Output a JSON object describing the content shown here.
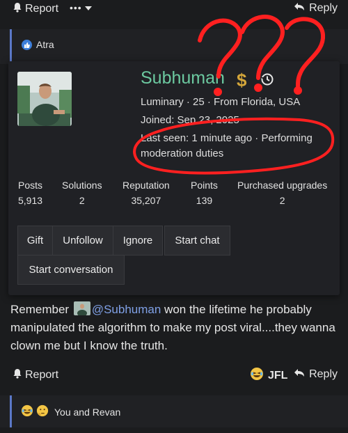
{
  "top": {
    "report_label": "Report",
    "more_label": "•••",
    "reply_label": "Reply"
  },
  "quote": {
    "user": "Atra"
  },
  "profile": {
    "name": "Subhuman",
    "dollar_symbol": "$",
    "line1": "Luminary · 25 · From Florida, USA",
    "line2": "Joined: Sep 23, 2025",
    "line3": "Last seen: 1 minute ago · Performing",
    "line4": "moderation duties",
    "stats": [
      {
        "label": "Posts",
        "value": "5,913"
      },
      {
        "label": "Solutions",
        "value": "2"
      },
      {
        "label": "Reputation",
        "value": "35,207"
      },
      {
        "label": "Points",
        "value": "139"
      },
      {
        "label": "Purchased upgrades",
        "value": "2"
      }
    ],
    "actions": [
      "Gift",
      "Unfollow",
      "Ignore",
      "Start chat",
      "Start conversation"
    ]
  },
  "post": {
    "before": "Remember",
    "mention": "@Subhuman",
    "after": " won the lifetime he probably manipulated the algorithm to make my post viral....they wanna clown me but I know the truth."
  },
  "footer": {
    "report_label": "Report",
    "jfl_label": "JFL",
    "reply_label": "Reply"
  },
  "reactions": {
    "text": "You and Revan"
  },
  "annotation": {
    "marks": "???",
    "color": "#ff2020"
  }
}
